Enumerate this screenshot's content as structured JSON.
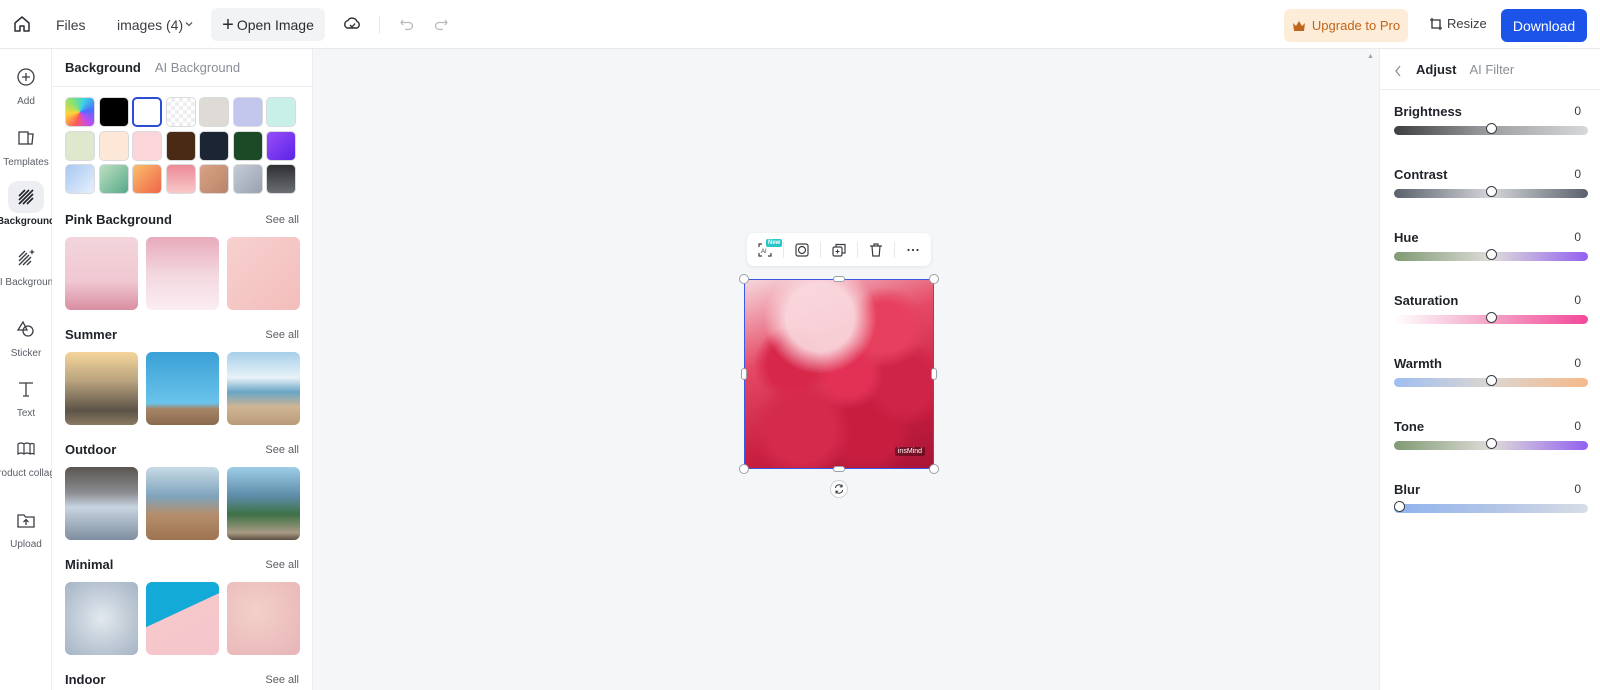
{
  "topbar": {
    "home_icon": "home-icon",
    "files_label": "Files",
    "project_name": "images (4)",
    "open_image_label": "Open Image",
    "cloud_icon": "cloud-sync-icon",
    "undo_icon": "undo-icon",
    "redo_icon": "redo-icon",
    "upgrade_label": "Upgrade to Pro",
    "resize_label": "Resize",
    "download_label": "Download",
    "accent_color": "#1c54ea",
    "upgrade_color": "#c0651c"
  },
  "leftnav": {
    "items": [
      {
        "label": "Add",
        "icon": "plus-circle-icon",
        "active": false
      },
      {
        "label": "Templates",
        "icon": "templates-icon",
        "active": false
      },
      {
        "label": "Background",
        "icon": "background-hatch-icon",
        "active": true
      },
      {
        "label": "AI Background",
        "icon": "ai-background-icon",
        "active": false
      },
      {
        "label": "Sticker",
        "icon": "sticker-icon",
        "active": false
      },
      {
        "label": "Text",
        "icon": "text-icon",
        "active": false
      },
      {
        "label": "Product collage",
        "icon": "collage-icon",
        "active": false
      },
      {
        "label": "Upload",
        "icon": "upload-icon",
        "active": false
      }
    ]
  },
  "panel": {
    "tabs": [
      {
        "label": "Background",
        "active": true
      },
      {
        "label": "AI Background",
        "active": false
      }
    ],
    "swatches": [
      {
        "name": "rainbow",
        "css": "conic-gradient(from 200deg, #ff5a5a, #ffd23a, #8de36b, #3ad3e6, #4a6cff, #c04cf0, #ff5a5a)"
      },
      {
        "name": "black",
        "css": "#000000"
      },
      {
        "name": "white",
        "css": "#ffffff",
        "selected": true
      },
      {
        "name": "transparent",
        "css": "repeating-conic-gradient(#eeeeee 0 25%, #ffffff 0 50%) 0 0/8px 8px"
      },
      {
        "name": "light-gray",
        "css": "#dedbd7"
      },
      {
        "name": "lavender",
        "css": "#c3c7ee"
      },
      {
        "name": "mint",
        "css": "#c8efe8"
      },
      {
        "name": "pale-green",
        "css": "#dde8cd"
      },
      {
        "name": "cream",
        "css": "#fde8d8"
      },
      {
        "name": "pale-pink",
        "css": "#fbd5d9"
      },
      {
        "name": "brown",
        "css": "#4a2915"
      },
      {
        "name": "navy",
        "css": "#1c2534"
      },
      {
        "name": "forest",
        "css": "#1d4a26"
      },
      {
        "name": "purple",
        "css": "linear-gradient(135deg, #9a4dfa, #5a23e6)"
      },
      {
        "name": "sky-gradient",
        "css": "linear-gradient(135deg, #a8c8f2, #e6f0fc)"
      },
      {
        "name": "green-gradient",
        "css": "linear-gradient(135deg, #bde0c0, #56a98a)"
      },
      {
        "name": "orange-gradient",
        "css": "linear-gradient(135deg, #f9c06a, #f0644a)"
      },
      {
        "name": "pink-gradient",
        "css": "linear-gradient(180deg, #ee8a98, #f7c8c8)"
      },
      {
        "name": "tan-gradient",
        "css": "linear-gradient(135deg, #d9a385, #b88468)"
      },
      {
        "name": "steel-gradient",
        "css": "linear-gradient(135deg, #c6ccd6, #98a2b0)"
      },
      {
        "name": "charcoal-gradient",
        "css": "linear-gradient(180deg, #2d2f32, #6b6e72)"
      }
    ],
    "sections": [
      {
        "title": "Pink Background",
        "see_all": "See all",
        "thumbs": [
          "linear-gradient(180deg, #f3d5dc 0%, #f0c8d2 60%, #d98ea2 100%)",
          "linear-gradient(180deg, #e8aabb 0%, #f2d6de 50%, #fbeef2 100%)",
          "linear-gradient(135deg, #f6d1cf 0%, #f3bdbb 100%)"
        ]
      },
      {
        "title": "Summer",
        "see_all": "See all",
        "thumbs": [
          "linear-gradient(180deg, #f5d59a 0%, #b8a27e 40%, #5c5448 80%, #8a7a62 100%)",
          "linear-gradient(180deg, #3aa0d6 0%, #6ac3ea 70%, #a58466 78%, #8a6a4e 100%)",
          "linear-gradient(180deg, #a6cfe8 0%, #e8f2f8 35%, #6aa5c4 55%, #cfb595 75%, #b89a78 100%)"
        ]
      },
      {
        "title": "Outdoor",
        "see_all": "See all",
        "thumbs": [
          "linear-gradient(180deg, #5a5550 0%, #8a8c90 35%, #c8d4e0 55%, #7e8ea0 100%)",
          "linear-gradient(180deg, #c8dae6 0%, #7ea4bc 40%, #b48e6c 65%, #9e7452 100%)",
          "linear-gradient(180deg, #9ecde8 0%, #5d8ca8 40%, #3e7246 65%, #a89a84 90%, #5a4e40 100%)"
        ]
      },
      {
        "title": "Minimal",
        "see_all": "See all",
        "thumbs": [
          "radial-gradient(circle at 50% 50%, #e2e8ee 0%, #a4b3c4 100%)",
          "linear-gradient(155deg, #13aad8 0%, #13aad8 42%, #f6c8cc 42.5%, #f4c6cc 100%)",
          "radial-gradient(circle at 40% 40%, #f2d0c8 0%, #e8b4b8 100%)"
        ]
      },
      {
        "title": "Indoor",
        "see_all": "See all",
        "thumbs": []
      }
    ]
  },
  "canvas": {
    "toolbar": [
      {
        "icon": "ai-icon",
        "badge": "New"
      },
      {
        "icon": "remove-bg-icon"
      },
      {
        "icon": "duplicate-icon"
      },
      {
        "icon": "delete-icon"
      },
      {
        "icon": "more-icon"
      }
    ],
    "image_watermark": "insMind",
    "rotate_icon": "rotate-icon",
    "selection_color": "#3a5ae6"
  },
  "rpanel": {
    "tabs": [
      {
        "label": "Adjust",
        "active": true
      },
      {
        "label": "AI Filter",
        "active": false
      }
    ],
    "adjustments": [
      {
        "label": "Brightness",
        "value": "0",
        "fraction": 0.5,
        "gradient": "linear-gradient(90deg, #3d3f42 0%, #9ea0a4 50%, #d6d8da 100%)"
      },
      {
        "label": "Contrast",
        "value": "0",
        "fraction": 0.5,
        "gradient": "linear-gradient(90deg, #5a616c 0%, #d4d6da 50%, #5a616c 100%)"
      },
      {
        "label": "Hue",
        "value": "0",
        "fraction": 0.5,
        "gradient": "linear-gradient(90deg, #7f9a72 0%, #dedcd8 50%, #9360f0 100%)"
      },
      {
        "label": "Saturation",
        "value": "0",
        "fraction": 0.5,
        "gradient": "linear-gradient(90deg, #ffffff 0%, #f4a3c6 50%, #f3489a 100%)"
      },
      {
        "label": "Warmth",
        "value": "0",
        "fraction": 0.5,
        "gradient": "linear-gradient(90deg, #9ebef2 0%, #dcd6d0 50%, #f6b88a 100%)"
      },
      {
        "label": "Tone",
        "value": "0",
        "fraction": 0.5,
        "gradient": "linear-gradient(90deg, #7f9a72 0%, #dedcd8 50%, #9360f0 100%)"
      },
      {
        "label": "Blur",
        "value": "0",
        "fraction": 0.0,
        "gradient": "linear-gradient(90deg, #8fb3ee 0%, #b8c8e6 60%, #d8dde6 100%)"
      }
    ]
  }
}
